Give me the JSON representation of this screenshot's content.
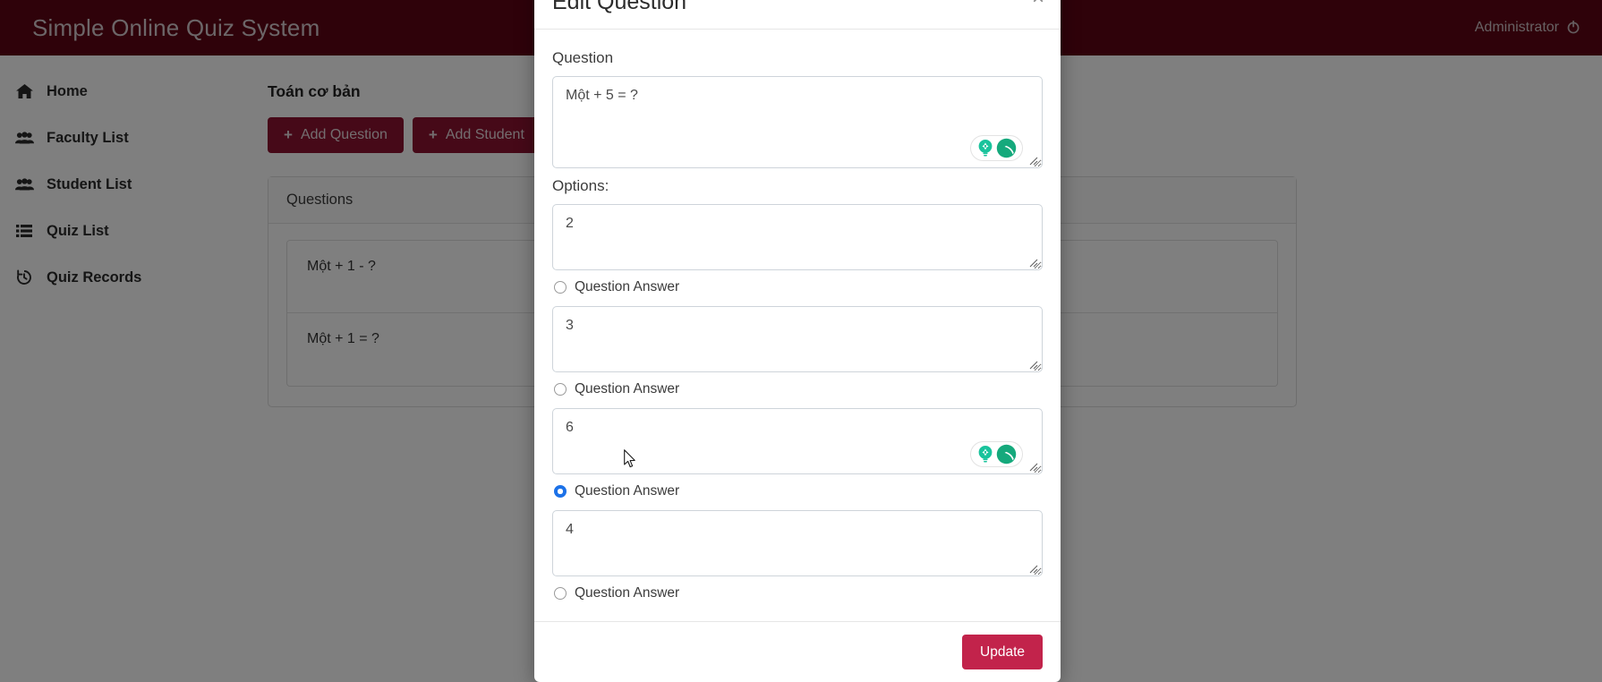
{
  "topbar": {
    "brand": "Simple Online Quiz System",
    "user": "Administrator",
    "power_icon": "power-icon"
  },
  "sidebar": {
    "items": [
      {
        "label": "Home",
        "icon": "home-icon"
      },
      {
        "label": "Faculty List",
        "icon": "users-icon"
      },
      {
        "label": "Student List",
        "icon": "users-icon"
      },
      {
        "label": "Quiz List",
        "icon": "list-icon"
      },
      {
        "label": "Quiz Records",
        "icon": "history-icon"
      }
    ]
  },
  "content": {
    "quiz_title": "Toán cơ bản",
    "buttons": [
      {
        "label": "Add Question",
        "icon": "plus-icon"
      },
      {
        "label": "Add Student",
        "icon": "plus-icon"
      }
    ],
    "panel_header": "Questions",
    "questions": [
      "Một + 1 - ?",
      "Một + 1 = ?"
    ]
  },
  "modal": {
    "title": "Edit Question",
    "close_label": "×",
    "question_label": "Question",
    "question_value": "Một + 5 = ?",
    "options_label": "Options:",
    "options": [
      {
        "value": "2",
        "answer_label": "Question Answer",
        "selected": false,
        "grammarly": false
      },
      {
        "value": "3",
        "answer_label": "Question Answer",
        "selected": false,
        "grammarly": false
      },
      {
        "value": "6",
        "answer_label": "Question Answer",
        "selected": true,
        "grammarly": true
      },
      {
        "value": "4",
        "answer_label": "Question Answer",
        "selected": false,
        "grammarly": false
      }
    ],
    "footer_button": "Update",
    "grammarly_icons": [
      "lightbulb-icon",
      "grammarly-logo-icon"
    ]
  },
  "colors": {
    "brand_maroon": "#5e0415",
    "button_crimson": "#8d1230",
    "danger": "#c2234b",
    "radio_selected": "#1d72e8",
    "grammarly_green": "#15c39a"
  }
}
